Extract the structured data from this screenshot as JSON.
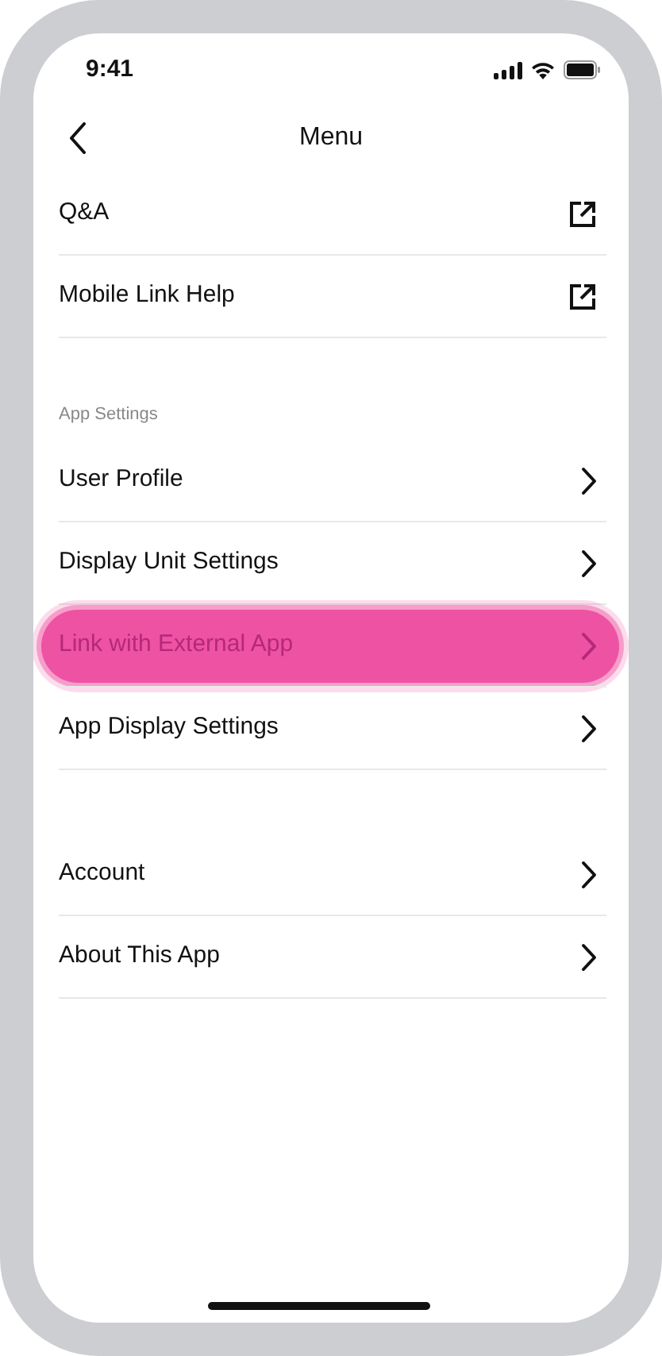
{
  "status_bar": {
    "time": "9:41"
  },
  "nav": {
    "title": "Menu"
  },
  "sections": [
    {
      "items": [
        {
          "label": "Q&A",
          "kind": "external",
          "highlighted": false
        },
        {
          "label": "Mobile Link Help",
          "kind": "external",
          "highlighted": false
        }
      ]
    },
    {
      "header": "App Settings",
      "items": [
        {
          "label": "User Profile",
          "kind": "chevron",
          "highlighted": false
        },
        {
          "label": "Display Unit Settings",
          "kind": "chevron",
          "highlighted": false
        },
        {
          "label": "Link with External App",
          "kind": "chevron",
          "highlighted": true
        },
        {
          "label": "App Display Settings",
          "kind": "chevron",
          "highlighted": false
        }
      ]
    },
    {
      "items": [
        {
          "label": "Account",
          "kind": "chevron",
          "highlighted": false
        },
        {
          "label": "About This App",
          "kind": "chevron",
          "highlighted": false
        }
      ]
    }
  ]
}
